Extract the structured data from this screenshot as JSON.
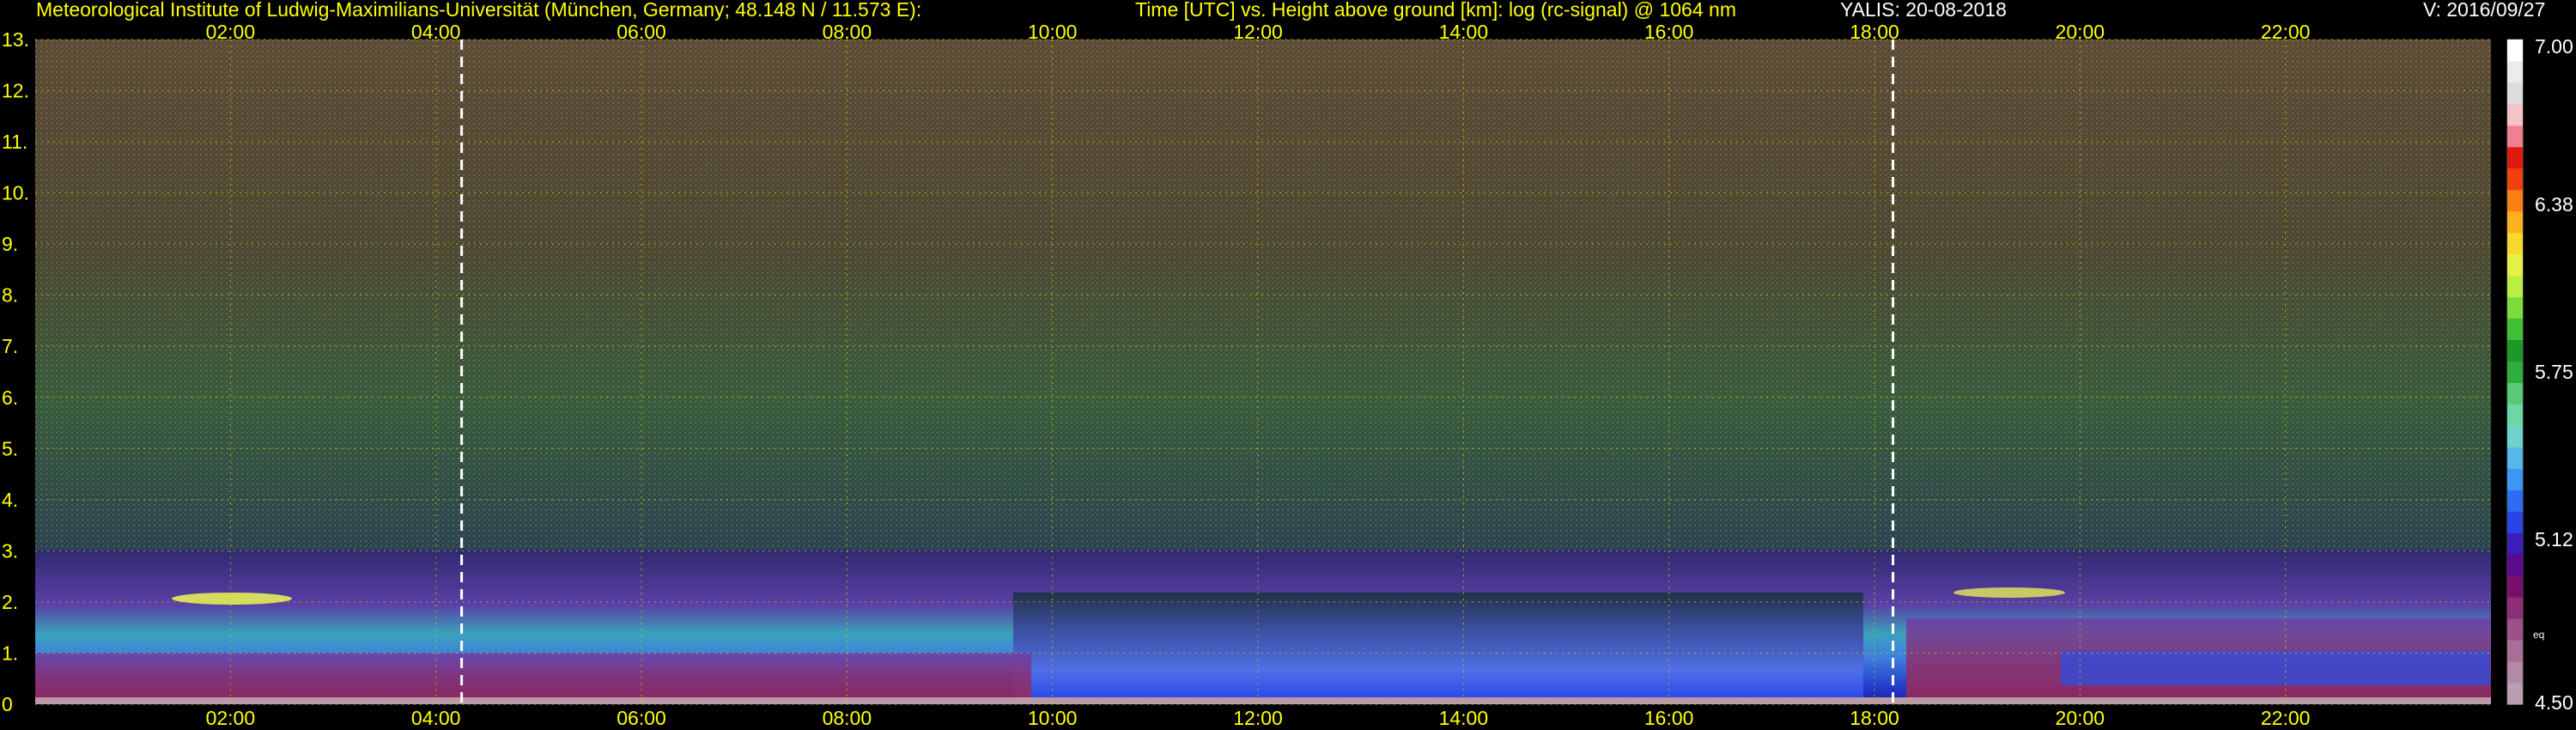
{
  "header": {
    "institute": "Meteorological Institute of Ludwig-Maximilians-Universität (München, Germany; 48.148 N / 11.573 E):",
    "plot_title": "Time [UTC] vs. Height above ground [km]: log (rc-signal) @ 1064 nm",
    "instrument_date": "YALIS: 20-08-2018",
    "version": "V: 2016/09/27"
  },
  "colorbar": {
    "tick_labels": [
      "7.00",
      "6.38",
      "5.75",
      "5.12",
      "4.50"
    ],
    "tick_values": [
      7.0,
      6.38,
      5.75,
      5.12,
      4.5
    ],
    "eq_label": "eq",
    "colors": [
      "#b99fb0",
      "#b38aa5",
      "#a96f98",
      "#9c5289",
      "#8c2f78",
      "#7a0e6c",
      "#5b0a8a",
      "#3d1cb8",
      "#2a44e6",
      "#2f6cf2",
      "#3f95f3",
      "#56b7e8",
      "#6fd2cd",
      "#6fd6a6",
      "#59c97a",
      "#2fae3d",
      "#1c9926",
      "#3fbf35",
      "#7cdc3e",
      "#b9ee44",
      "#e6f048",
      "#f7d82c",
      "#fbb01e",
      "#fb7f14",
      "#f2410e",
      "#e01a12",
      "#f07f90",
      "#f3c3c8",
      "#dcdcdc",
      "#ececec",
      "#ffffff"
    ]
  },
  "chart_data": {
    "type": "heatmap",
    "title": "Time [UTC] vs. Height above ground [km]: log (rc-signal) @ 1064 nm",
    "xlabel": "Time [UTC]",
    "ylabel": "Height above ground [km]",
    "x_unit": "hours UTC",
    "xlim": [
      0.1,
      24.0
    ],
    "ylim": [
      0,
      13
    ],
    "x_tick_labels": [
      "02:00",
      "04:00",
      "06:00",
      "08:00",
      "10:00",
      "12:00",
      "14:00",
      "16:00",
      "18:00",
      "20:00",
      "22:00"
    ],
    "x_tick_values": [
      2,
      4,
      6,
      8,
      10,
      12,
      14,
      16,
      18,
      20,
      22
    ],
    "y_tick_labels": [
      "0",
      "1.",
      "2.",
      "3.",
      "4.",
      "5.",
      "6.",
      "7.",
      "8.",
      "9.",
      "10.",
      "11.",
      "12.",
      "13."
    ],
    "y_tick_values": [
      0,
      1,
      2,
      3,
      4,
      5,
      6,
      7,
      8,
      9,
      10,
      11,
      12,
      13
    ],
    "color_range": [
      4.5,
      7.0
    ],
    "grid": true,
    "markers_dashed_white_hours": [
      4.25,
      18.18
    ],
    "colorbar_position": "right"
  }
}
